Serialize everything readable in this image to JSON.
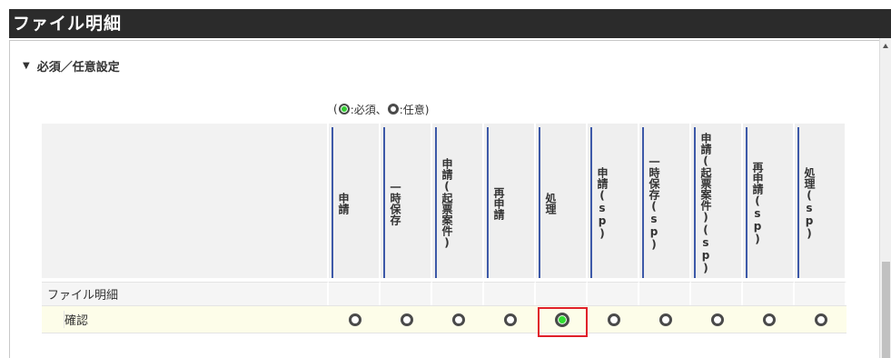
{
  "window": {
    "title": "ファイル明細"
  },
  "section": {
    "label": "必須／任意設定",
    "expanded": true
  },
  "legend": {
    "open": "(",
    "required": ":必須、",
    "optional": ":任意)"
  },
  "columns": [
    "申請",
    "一時保存",
    "申請(起票案件)",
    "再申請",
    "処理",
    "申請(sp)",
    "一時保存(sp)",
    "申請(起票案件)(sp)",
    "再申請(sp)",
    "処理(sp)"
  ],
  "rows": [
    {
      "group": "ファイル明細"
    },
    {
      "item": "確認",
      "selected": [
        false,
        false,
        false,
        false,
        true,
        false,
        false,
        false,
        false,
        false
      ]
    }
  ],
  "colors": {
    "header_bar": "#2b2b2b",
    "accent_line": "#3d59a8",
    "selected_radio": "#33dd33",
    "highlight_box": "#e0202a",
    "row_highlight": "#fdfde9"
  }
}
